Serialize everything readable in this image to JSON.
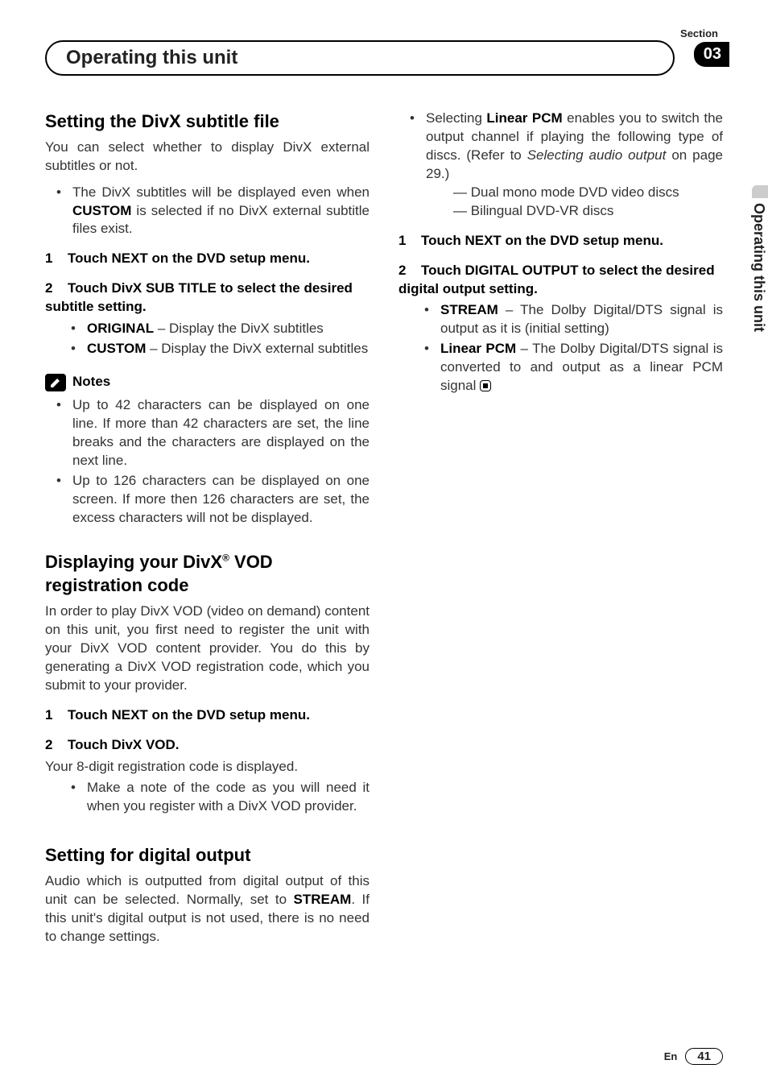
{
  "header": {
    "section_label": "Section",
    "section_number": "03",
    "chapter_title": "Operating this unit",
    "side_tab": "Operating this unit"
  },
  "col1": {
    "s1": {
      "heading": "Setting the DivX subtitle file",
      "intro": "You can select whether to display DivX external subtitles or not.",
      "bullet1_a": "The DivX subtitles will be displayed even when ",
      "bullet1_bold": "CUSTOM",
      "bullet1_b": " is selected if no DivX external subtitle files exist.",
      "step1_num": "1",
      "step1": "Touch NEXT on the DVD setup menu.",
      "step2_num": "2",
      "step2": "Touch DivX SUB TITLE to select the desired subtitle setting.",
      "opt1_bold": "ORIGINAL",
      "opt1_rest": " – Display the DivX subtitles",
      "opt2_bold": "CUSTOM",
      "opt2_rest": " – Display the DivX external subtitles",
      "notes_label": "Notes",
      "note1": "Up to 42 characters can be displayed on one line. If more than 42 characters are set, the line breaks and the characters are displayed on the next line.",
      "note2": "Up to 126 characters can be displayed on one screen. If more then 126 characters are set, the excess characters will not be displayed."
    },
    "s2": {
      "heading_a": "Displaying your DivX",
      "heading_sup": "®",
      "heading_b": " VOD registration code",
      "intro": "In order to play DivX VOD (video on demand) content on this unit, you first need to register the unit with your DivX VOD content provider. You do this by generating a DivX VOD registration code, which you submit to your provider.",
      "step1_num": "1",
      "step1": "Touch NEXT on the DVD setup menu.",
      "step2_num": "2",
      "step2": "Touch DivX VOD.",
      "sub": "Your 8-digit registration code is displayed.",
      "bullet": "Make a note of the code as you will need it when you register with a DivX VOD provider."
    },
    "s3": {
      "heading": "Setting for digital output",
      "intro_a": "Audio which is outputted from digital output of this unit can be selected. Normally, set to ",
      "intro_bold": "STREAM",
      "intro_b": ". If this unit's digital output is not used, there is no need to change settings."
    }
  },
  "col2": {
    "top_bullet_a": "Selecting ",
    "top_bullet_bold": "Linear PCM",
    "top_bullet_b": " enables you to switch the output channel if playing the following type of discs. (Refer to ",
    "top_bullet_italic": "Selecting audio output",
    "top_bullet_c": " on page 29.)",
    "dash1": "Dual mono mode DVD video discs",
    "dash2": "Bilingual DVD-VR discs",
    "step1_num": "1",
    "step1": "Touch NEXT on the DVD setup menu.",
    "step2_num": "2",
    "step2": "Touch DIGITAL OUTPUT to select the desired digital output setting.",
    "opt1_bold": "STREAM",
    "opt1_rest": " – The Dolby Digital/DTS signal is output as it is (initial setting)",
    "opt2_bold": "Linear PCM",
    "opt2_rest": " – The Dolby Digital/DTS signal is converted to and output as a linear PCM signal"
  },
  "footer": {
    "lang": "En",
    "page": "41"
  }
}
